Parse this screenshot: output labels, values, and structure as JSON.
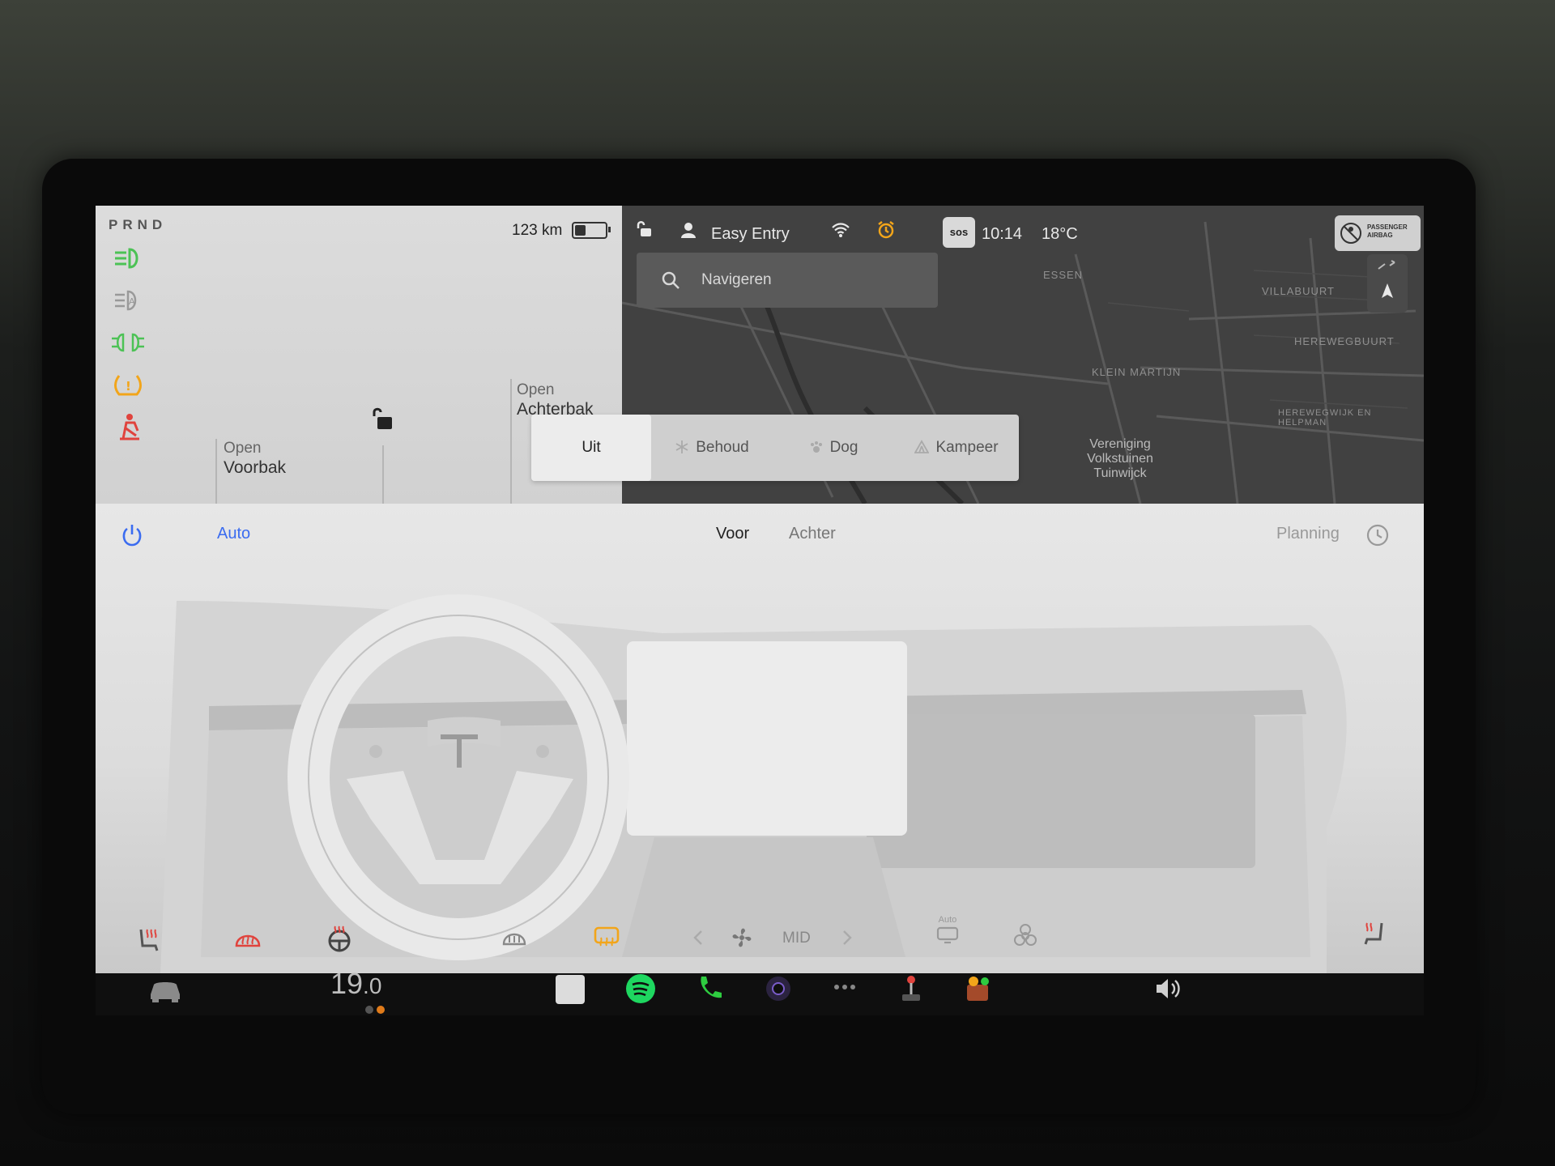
{
  "status": {
    "gear": "PRND",
    "range": "123 km",
    "battery_level": 0.35,
    "profile": "Easy Entry",
    "sos": "sos",
    "time": "10:14",
    "outside_temp": "18°C",
    "airbag_text": "PASSENGER AIRBAG"
  },
  "doors": {
    "frunk": {
      "state": "Open",
      "name": "Voorbak"
    },
    "trunk": {
      "state": "Open",
      "name": "Achterbak"
    }
  },
  "search": {
    "placeholder": "Navigeren"
  },
  "map": {
    "labels": [
      "ESSEN",
      "VILLABUURT",
      "KLEIN MARTIJN",
      "HEREWEGBUURT",
      "HEREWEGWIJK EN HELPMAN",
      "Vereniging Volkstuinen Tuinwijck"
    ]
  },
  "modes": [
    "Uit",
    "Behoud",
    "Dog",
    "Kampeer"
  ],
  "climate": {
    "auto_label": "Auto",
    "tab_front": "Voor",
    "tab_rear": "Achter",
    "planning_label": "Planning",
    "fan_level": "MID",
    "recirc_auto": "Auto"
  },
  "taskbar": {
    "cabin_temp": "19",
    "cabin_temp_decimal": ".0"
  },
  "colors": {
    "accent_blue": "#3b6cf0",
    "tell_green": "#4cc255",
    "tell_amber": "#f2a51a",
    "tell_red": "#e0433d",
    "spotify": "#1ed760",
    "phone": "#2ecc40"
  }
}
